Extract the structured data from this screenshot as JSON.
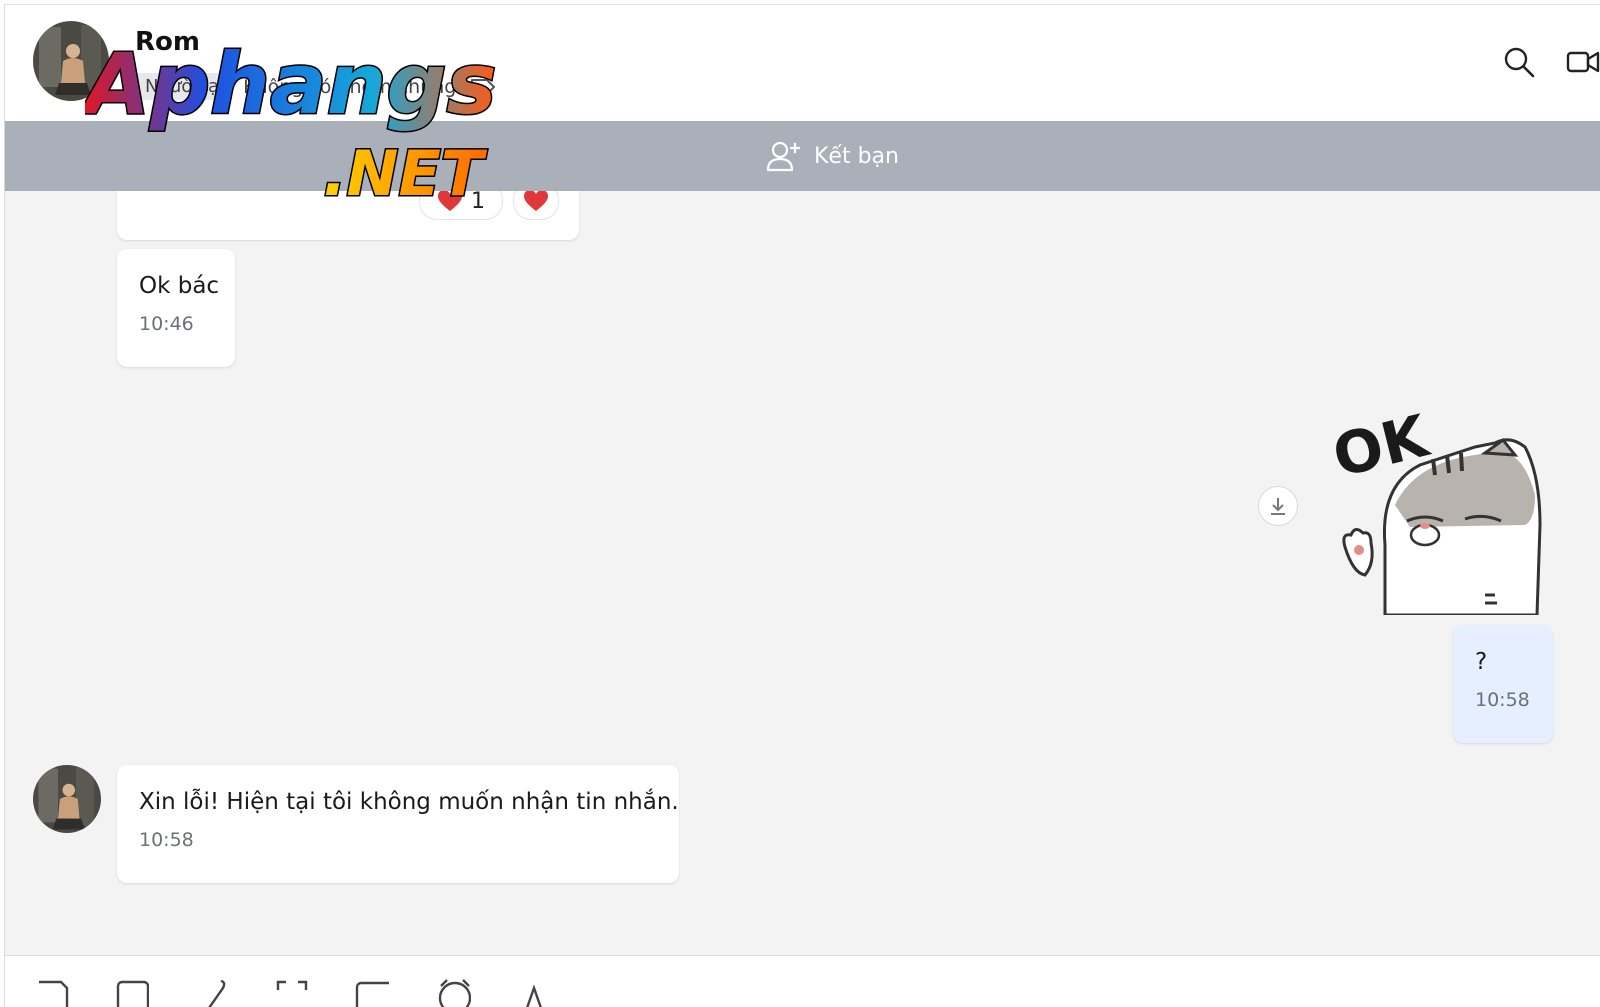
{
  "header": {
    "contact_name": "Rom",
    "stranger_badge": "Người lạ",
    "subline_text": "Không có nhóm chung"
  },
  "watermark": {
    "line1": "Aphangs",
    "line2": ".NET"
  },
  "friend_bar": {
    "label": "Kết bạn"
  },
  "messages": [
    {
      "text": "",
      "time": "",
      "reactions": [
        {
          "icon": "heart-icon",
          "count": "1"
        },
        {
          "icon": "heart-icon",
          "count": ""
        }
      ]
    },
    {
      "text": "Ok bác",
      "time": "10:46"
    },
    {
      "sticker": "cat-ok-sticker",
      "sticker_text": "OK"
    },
    {
      "text": "?",
      "time": "10:58"
    },
    {
      "text": "Xin lỗi! Hiện tại tôi không muốn nhận tin nhắn.",
      "time": "10:58"
    }
  ],
  "toolbar": {
    "tools": [
      "sticker-icon",
      "image-icon",
      "attachment-icon",
      "screenshot-icon",
      "card-icon",
      "reminder-icon",
      "format-icon"
    ]
  },
  "colors": {
    "friend_bar_bg": "#aab0b9",
    "own_bubble_bg": "#e5efff",
    "chat_bg": "#f3f3f4",
    "heart": "#e0373b"
  }
}
